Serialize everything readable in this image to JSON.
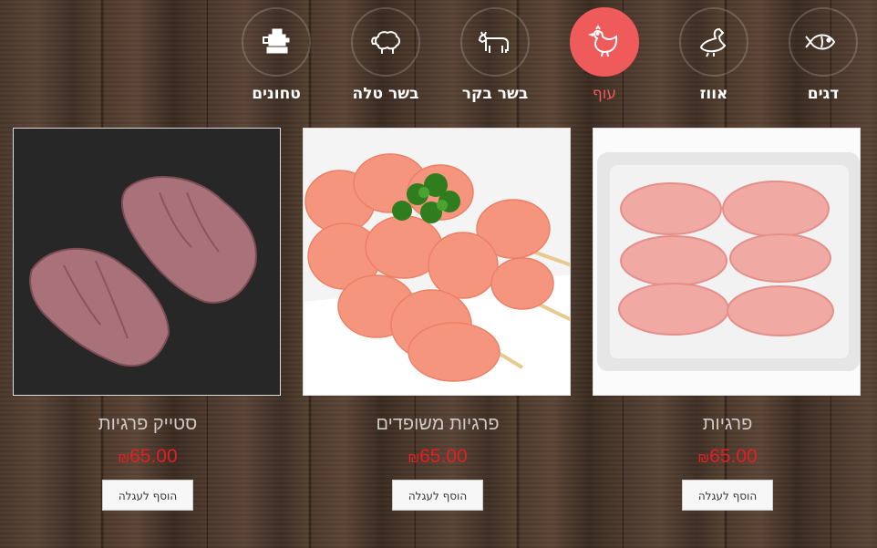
{
  "categories": [
    {
      "label": "דגים",
      "icon": "fish-icon",
      "active": false
    },
    {
      "label": "אווז",
      "icon": "goose-icon",
      "active": false
    },
    {
      "label": "עוף",
      "icon": "chicken-icon",
      "active": true
    },
    {
      "label": "בשר בקר",
      "icon": "cow-icon",
      "active": false
    },
    {
      "label": "בשר טלה",
      "icon": "sheep-icon",
      "active": false
    },
    {
      "label": "טחונים",
      "icon": "meat-grinder-icon",
      "active": false
    }
  ],
  "products": [
    {
      "name": "פרגיות",
      "price": "65.00",
      "currency": "₪",
      "button": "הוסף לעגלה",
      "image": "chicken-thighs-in-tray"
    },
    {
      "name": "פרגיות משופדים",
      "price": "65.00",
      "currency": "₪",
      "button": "הוסף לעגלה",
      "image": "chicken-skewers-with-parsley"
    },
    {
      "name": "סטייק פרגיות",
      "price": "65.00",
      "currency": "₪",
      "button": "הוסף לעגלה",
      "image": "chicken-thigh-steaks-on-slate"
    }
  ],
  "colors": {
    "accent": "#ef5b5b",
    "price": "#e31e24"
  }
}
